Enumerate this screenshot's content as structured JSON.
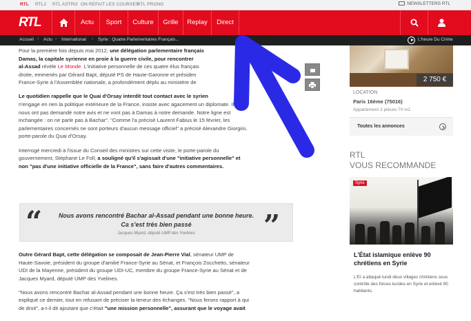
{
  "topbar": {
    "links": [
      {
        "label": "RTL",
        "active": true
      },
      {
        "label": "RTL2",
        "active": false
      },
      {
        "label": "RTL ASTRO",
        "active": false
      },
      {
        "label": "ON REFAIT LES COURSES",
        "active": false
      },
      {
        "label": "RTL PRONO",
        "active": false
      }
    ],
    "newsletters": "NEWSLETTERS RTL"
  },
  "nav": {
    "logo": "RTL",
    "items": [
      "Actu",
      "Sport",
      "Culture",
      "Grille",
      "Replay",
      "Direct"
    ]
  },
  "breadcrumb": {
    "items": [
      "Accueil",
      "Actu",
      "International",
      "Syrie : Quatre Parlementaires Français..."
    ],
    "right_label": "L'heure Du Crime"
  },
  "article": {
    "p1_a": "Pour la première fois depuis mai 2012, ",
    "p1_b": "une délégation parlementaire français",
    "p1_c": "Damas, la capitale syrienne en proie à la guerre civile, pour rencontrer",
    "p1_d": "al-Assad",
    "p1_e": " révèle ",
    "p1_f": "Le Monde",
    "p1_g": ". L'initiative personnelle de ces quatre élus français",
    "p1_h": "droite, emmenés par Gérard Bapt, député PS de Haute-Garonne et présiden",
    "p1_i": "France-Syrie à l'Assemblée nationale, a profondément déplu au ministère de",
    "p2_a": "Le quotidien rappelle que le Quai d'Orsay interdit tout contact avec le",
    "p2_a2": " syrien",
    "p2_b": "n'engage en rien la politique extérieure de la France, insiste avec agacement un diplomate. Ils",
    "p2_c": "nous ont pas demandé notre avis et ne vont pas à Damas à notre demande. Notre ligne est",
    "p2_d": "inchangée : on ne parle pas à Bachar\". \"Comme l'a précisé Laurent Fabius le 15 février, les",
    "p2_e": "parlementaires concernés ne sont porteurs d'aucun message officiel\" a précisé Alexandre Giorgini,",
    "p2_f": "porte-parole du Quai d'Orsay.",
    "p3_a": "Interrogé mercredi à l'issue du Conseil des ministres sur cette visite, le porte-parole du",
    "p3_b": "gouvernement, Stéphane Le Foll, ",
    "p3_c": "a souligné qu'il s'agissait d'une \"initiative personnelle\" et",
    "p3_d": "non \"pas d'une initiative officielle de la France\", sans faire d'autres commentaires.",
    "quote_text": "Nous avons rencontré Bachar al-Assad pendant une bonne heure. Ca s'est très bien passé",
    "quote_source": "Jacques Myard, député UMP des Yvelines",
    "p4_a": "Outre Gérard Bapt, cette délégation se composait de Jean-Pierre Vial",
    "p4_b": ", sénateur UMP de",
    "p4_c": "Haute-Savoie, président du groupe d'amitié France-Syrie au Sénat, et François Zocchetto, sénateur",
    "p4_d": "UDI de la Mayenne, président du groupe UDI-UC, membre du groupe France-Syrie au Sénat et de",
    "p4_e": "Jacques Myard, député UMP des Yvelines.",
    "p5_a": "\"Nous avons rencontré Bachar al-Assad pendant une bonne heure. Ça s'est très bien passé\", a",
    "p5_b": "expliqué ce dernier, tout en refusant de préciser la teneur des échanges. \"Nous ferons rapport à qui",
    "p5_c": "de droit\", a-t-il dit ajoutant que c'était ",
    "p5_d": "\"une mission personnelle\"",
    "p5_e": ", assurant que le voyage avait"
  },
  "listing": {
    "price": "2 750 €",
    "location_label": "LOCATION",
    "location_name": "Paris 16ème (75016)",
    "location_desc": "Appartement 3 pièces 70 m2",
    "all_ads": "Toutes les annonces"
  },
  "recommend": {
    "title_line1": "RTL",
    "title_line2": "VOUS RECOMMANDE",
    "tag": "Syrie",
    "headline": "L'État islamique enlève 90 chrétiens en Syrie",
    "desc": "L'EI a attaqué lundi deux villages chrétiens sous contrôle des forces kurdes en Syrie et enlevé 90 habitants."
  },
  "colors": {
    "brand_red": "#e30b1e",
    "breadcrumb_bg": "#1f1f1f",
    "annotation_arrow": "#2a2ae6"
  },
  "icons": [
    "home-icon",
    "search-icon",
    "user-icon",
    "play-circle-icon",
    "print-icon",
    "share-icon",
    "chevron-right-icon",
    "newsletter-icon"
  ]
}
